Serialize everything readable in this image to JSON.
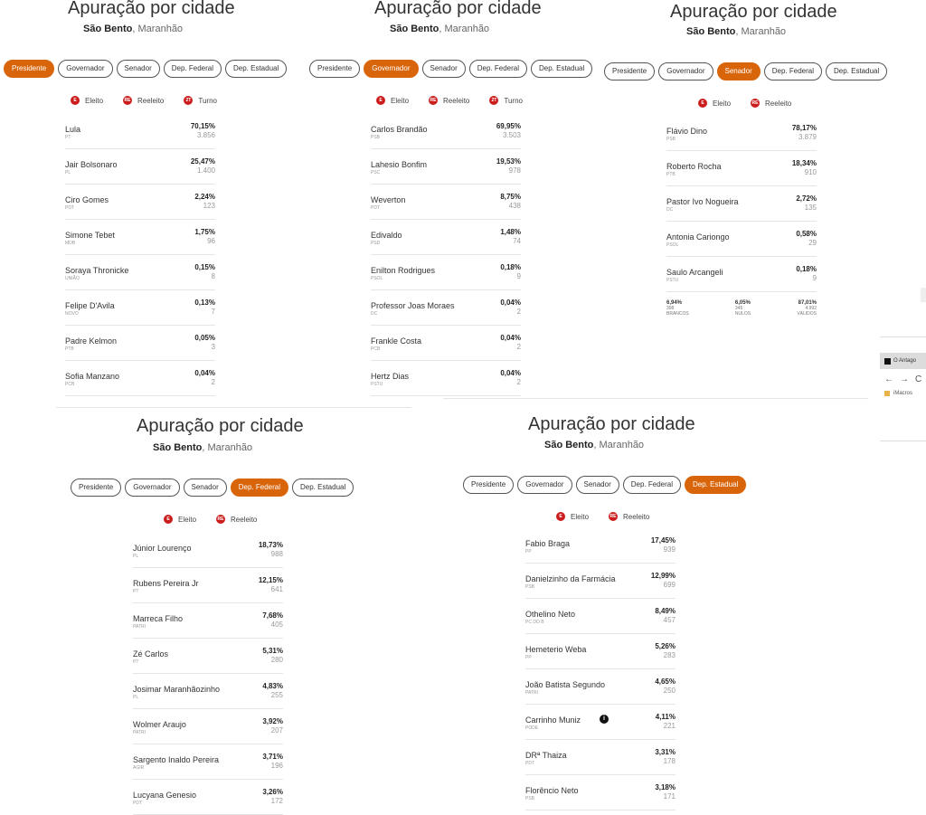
{
  "panel_title": "Apuração por cidade",
  "city": "São Bento",
  "state": ", Maranhão",
  "tabs": [
    "Presidente",
    "Governador",
    "Senador",
    "Dep. Federal",
    "Dep. Estadual"
  ],
  "legend": {
    "elected_badge": "E",
    "elected_label": "Eleito",
    "reelected_badge": "RE",
    "reelected_label": "Reeleito",
    "runoff_badge": "2T",
    "runoff_label": "Turno"
  },
  "accent_color": "#d9650b",
  "presidente": [
    {
      "name": "Lula",
      "party": "PT",
      "pct": "70,15%",
      "votes": "3.856"
    },
    {
      "name": "Jair Bolsonaro",
      "party": "PL",
      "pct": "25,47%",
      "votes": "1.400"
    },
    {
      "name": "Ciro Gomes",
      "party": "PDT",
      "pct": "2,24%",
      "votes": "123"
    },
    {
      "name": "Simone Tebet",
      "party": "MDB",
      "pct": "1,75%",
      "votes": "96"
    },
    {
      "name": "Soraya Thronicke",
      "party": "UNIÃO",
      "pct": "0,15%",
      "votes": "8"
    },
    {
      "name": "Felipe D'Avila",
      "party": "NOVO",
      "pct": "0,13%",
      "votes": "7"
    },
    {
      "name": "Padre Kelmon",
      "party": "PTB",
      "pct": "0,05%",
      "votes": "3"
    },
    {
      "name": "Sofia Manzano",
      "party": "PCB",
      "pct": "0,04%",
      "votes": "2"
    }
  ],
  "governador": [
    {
      "name": "Carlos Brandão",
      "party": "PSB",
      "pct": "69,95%",
      "votes": "3.503"
    },
    {
      "name": "Lahesio Bonfim",
      "party": "PSC",
      "pct": "19,53%",
      "votes": "978"
    },
    {
      "name": "Weverton",
      "party": "PDT",
      "pct": "8,75%",
      "votes": "438"
    },
    {
      "name": "Edivaldo",
      "party": "PSD",
      "pct": "1,48%",
      "votes": "74"
    },
    {
      "name": "Enilton Rodrigues",
      "party": "PSOL",
      "pct": "0,18%",
      "votes": "9"
    },
    {
      "name": "Professor Joas Moraes",
      "party": "DC",
      "pct": "0,04%",
      "votes": "2"
    },
    {
      "name": "Frankle Costa",
      "party": "PCB",
      "pct": "0,04%",
      "votes": "2"
    },
    {
      "name": "Hertz Dias",
      "party": "PSTU",
      "pct": "0,04%",
      "votes": "2"
    }
  ],
  "senador": [
    {
      "name": "Flávio Dino",
      "party": "PSB",
      "pct": "78,17%",
      "votes": "3.879"
    },
    {
      "name": "Roberto Rocha",
      "party": "PTB",
      "pct": "18,34%",
      "votes": "910"
    },
    {
      "name": "Pastor Ivo Nogueira",
      "party": "DC",
      "pct": "2,72%",
      "votes": "135"
    },
    {
      "name": "Antonia Cariongo",
      "party": "PSOL",
      "pct": "0,58%",
      "votes": "29"
    },
    {
      "name": "Saulo Arcangeli",
      "party": "PSTU",
      "pct": "0,18%",
      "votes": "9"
    }
  ],
  "senador_summary": [
    {
      "pct": "6,94%",
      "votes": "398",
      "label": "BRANCOS"
    },
    {
      "pct": "6,05%",
      "votes": "345",
      "label": "NULOS"
    },
    {
      "pct": "87,01%",
      "votes": "4.992",
      "label": "VÁLIDOS"
    }
  ],
  "federal": [
    {
      "name": "Júnior Lourenço",
      "party": "PL",
      "pct": "18,73%",
      "votes": "988"
    },
    {
      "name": "Rubens Pereira Jr",
      "party": "PT",
      "pct": "12,15%",
      "votes": "641"
    },
    {
      "name": "Marreca Filho",
      "party": "PATRI",
      "pct": "7,68%",
      "votes": "405"
    },
    {
      "name": "Zé Carlos",
      "party": "PT",
      "pct": "5,31%",
      "votes": "280"
    },
    {
      "name": "Josimar Maranhãozinho",
      "party": "PL",
      "pct": "4,83%",
      "votes": "255"
    },
    {
      "name": "Wolmer Araujo",
      "party": "PATRI",
      "pct": "3,92%",
      "votes": "207"
    },
    {
      "name": "Sargento Inaldo Pereira",
      "party": "AGIR",
      "pct": "3,71%",
      "votes": "196"
    },
    {
      "name": "Lucyana Genesio",
      "party": "PDT",
      "pct": "3,26%",
      "votes": "172"
    }
  ],
  "estadual": [
    {
      "name": "Fabio Braga",
      "party": "PP",
      "pct": "17,45%",
      "votes": "939"
    },
    {
      "name": "Danielzinho da Farmácia",
      "party": "PSB",
      "pct": "12,99%",
      "votes": "699"
    },
    {
      "name": "Othelino Neto",
      "party": "PC DO B",
      "pct": "8,49%",
      "votes": "457"
    },
    {
      "name": "Hemeterio Weba",
      "party": "PP",
      "pct": "5,26%",
      "votes": "283"
    },
    {
      "name": "João Batista Segundo",
      "party": "PATRI",
      "pct": "4,65%",
      "votes": "250"
    },
    {
      "name": "Carrinho Muniz",
      "party": "PODE",
      "pct": "4,11%",
      "votes": "221",
      "info": "i"
    },
    {
      "name": "DRª Thaiza",
      "party": "PDT",
      "pct": "3,31%",
      "votes": "178"
    },
    {
      "name": "Florêncio Neto",
      "party": "PSB",
      "pct": "3,18%",
      "votes": "171"
    }
  ],
  "browser_fragment": {
    "tab_title": "O Antago",
    "nav_back": "←",
    "nav_forward": "→",
    "nav_reload": "C",
    "bookmark": "iMacros"
  }
}
